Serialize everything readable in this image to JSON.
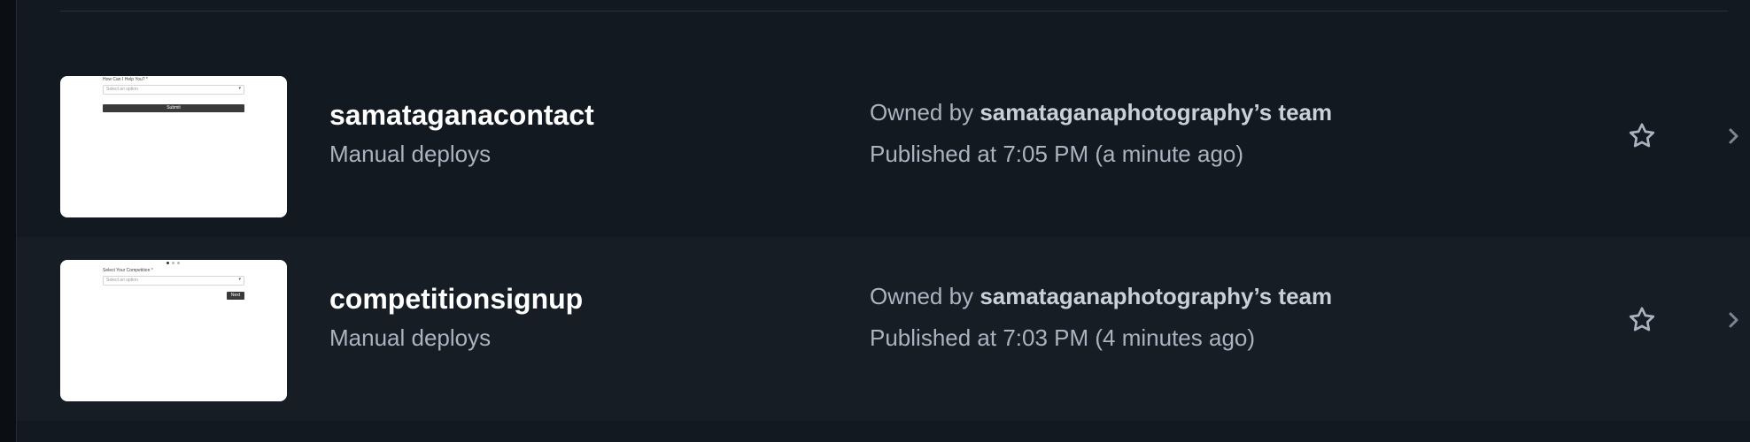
{
  "projects": [
    {
      "name": "samataganacontact",
      "deploy_type": "Manual deploys",
      "owned_prefix": "Owned by",
      "owner": "samataganaphotography’s team",
      "published": "Published at 7:05 PM (a minute ago)",
      "thumbnail": {
        "label": "How Can I Help You? *",
        "select_placeholder": "Select an option",
        "button": "Submit"
      }
    },
    {
      "name": "competitionsignup",
      "deploy_type": "Manual deploys",
      "owned_prefix": "Owned by",
      "owner": "samataganaphotography’s team",
      "published": "Published at 7:03 PM (4 minutes ago)",
      "thumbnail": {
        "label": "Select Your Competition *",
        "select_placeholder": "Select an option",
        "button": "Next"
      }
    }
  ],
  "icons": {
    "favorite": "star-icon",
    "open": "chevron-right-icon"
  },
  "colors": {
    "background": "#131920",
    "row_alt": "#161d25",
    "title": "#ffffff",
    "muted": "#aab4c0",
    "icon": "#aab4c0"
  }
}
